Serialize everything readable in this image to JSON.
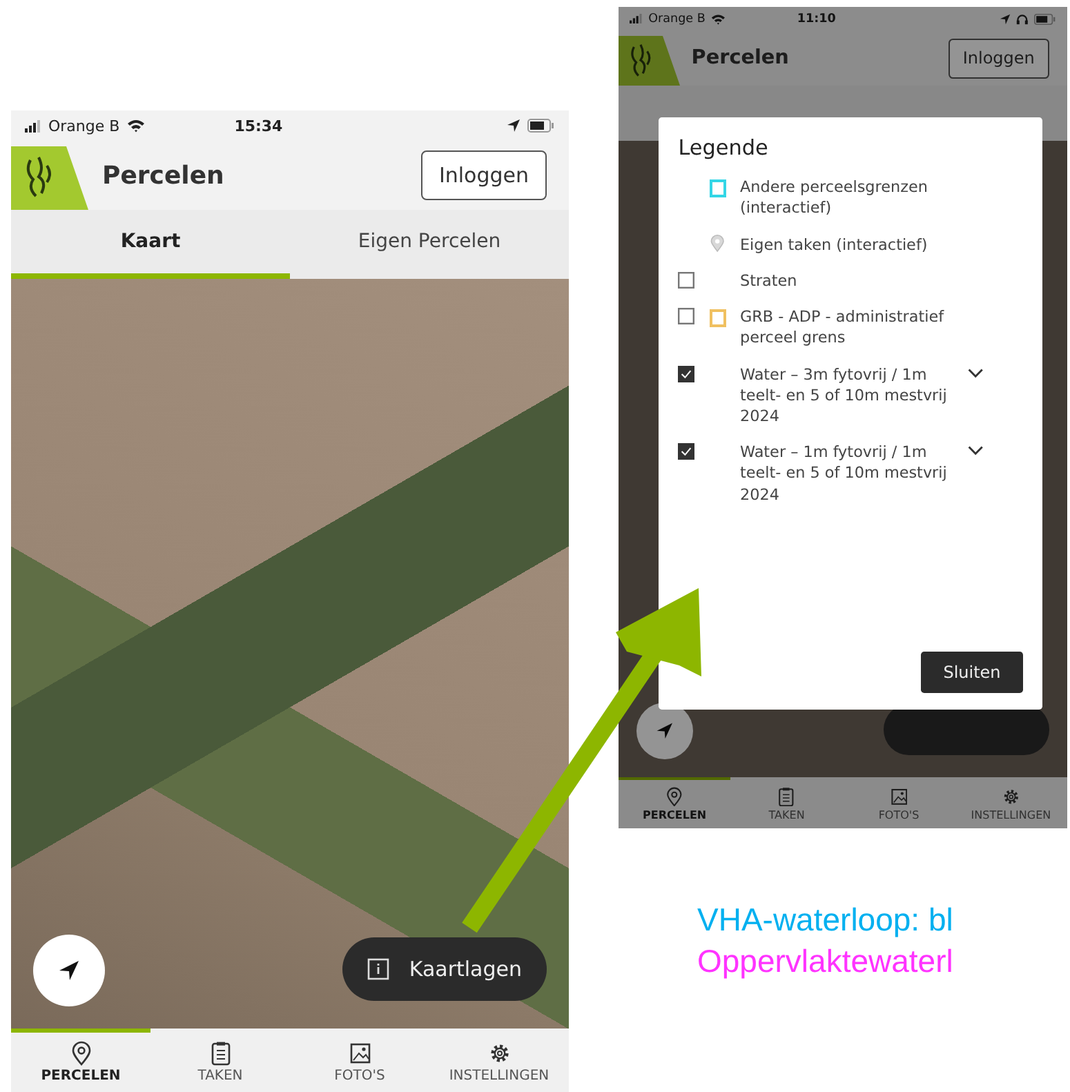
{
  "phones": [
    {
      "status_bar": {
        "carrier": "Orange B",
        "time": "15:34"
      },
      "header": {
        "title": "Percelen",
        "login_button": "Inloggen"
      },
      "tabs": [
        {
          "label": "Kaart",
          "selected": true
        },
        {
          "label": "Eigen Percelen",
          "selected": false
        }
      ],
      "map_button": {
        "label": "Kaartlagen"
      },
      "nav": [
        {
          "label": "PERCELEN",
          "selected": true
        },
        {
          "label": "TAKEN",
          "selected": false
        },
        {
          "label": "FOTO'S",
          "selected": false
        },
        {
          "label": "INSTELLINGEN",
          "selected": false
        }
      ]
    },
    {
      "status_bar": {
        "carrier": "Orange B",
        "time": "11:10",
        "headphones": true
      },
      "header": {
        "title": "Percelen",
        "login_button": "Inloggen"
      },
      "legend": {
        "title": "Legende",
        "items": [
          {
            "kind": "symbol",
            "color": "#33d6e6",
            "label": "Andere perceelsgrenzen (interactief)"
          },
          {
            "kind": "pin",
            "label": "Eigen taken (interactief)"
          },
          {
            "kind": "checkbox",
            "checked": false,
            "label": "Straten"
          },
          {
            "kind": "checkbox",
            "checked": false,
            "color": "#f0c060",
            "label": "GRB - ADP - administratief perceel grens"
          },
          {
            "kind": "checkbox",
            "checked": true,
            "expandable": true,
            "label": "Water – 3m fytovrij / 1m teelt- en 5 of 10m mestvrij 2024"
          },
          {
            "kind": "checkbox",
            "checked": true,
            "expandable": true,
            "label": "Water – 1m fytovrij / 1m teelt- en 5 of 10m mestvrij 2024"
          }
        ],
        "close_button": "Sluiten"
      },
      "nav": [
        {
          "label": "PERCELEN",
          "selected": true
        },
        {
          "label": "TAKEN",
          "selected": false
        },
        {
          "label": "FOTO'S",
          "selected": false
        },
        {
          "label": "INSTELLINGEN",
          "selected": false
        }
      ]
    }
  ],
  "captions": [
    {
      "text": "VHA-waterloop: bl",
      "color": "#00b0f0"
    },
    {
      "text": "Oppervlaktewaterl",
      "color": "#ff33ff"
    }
  ]
}
